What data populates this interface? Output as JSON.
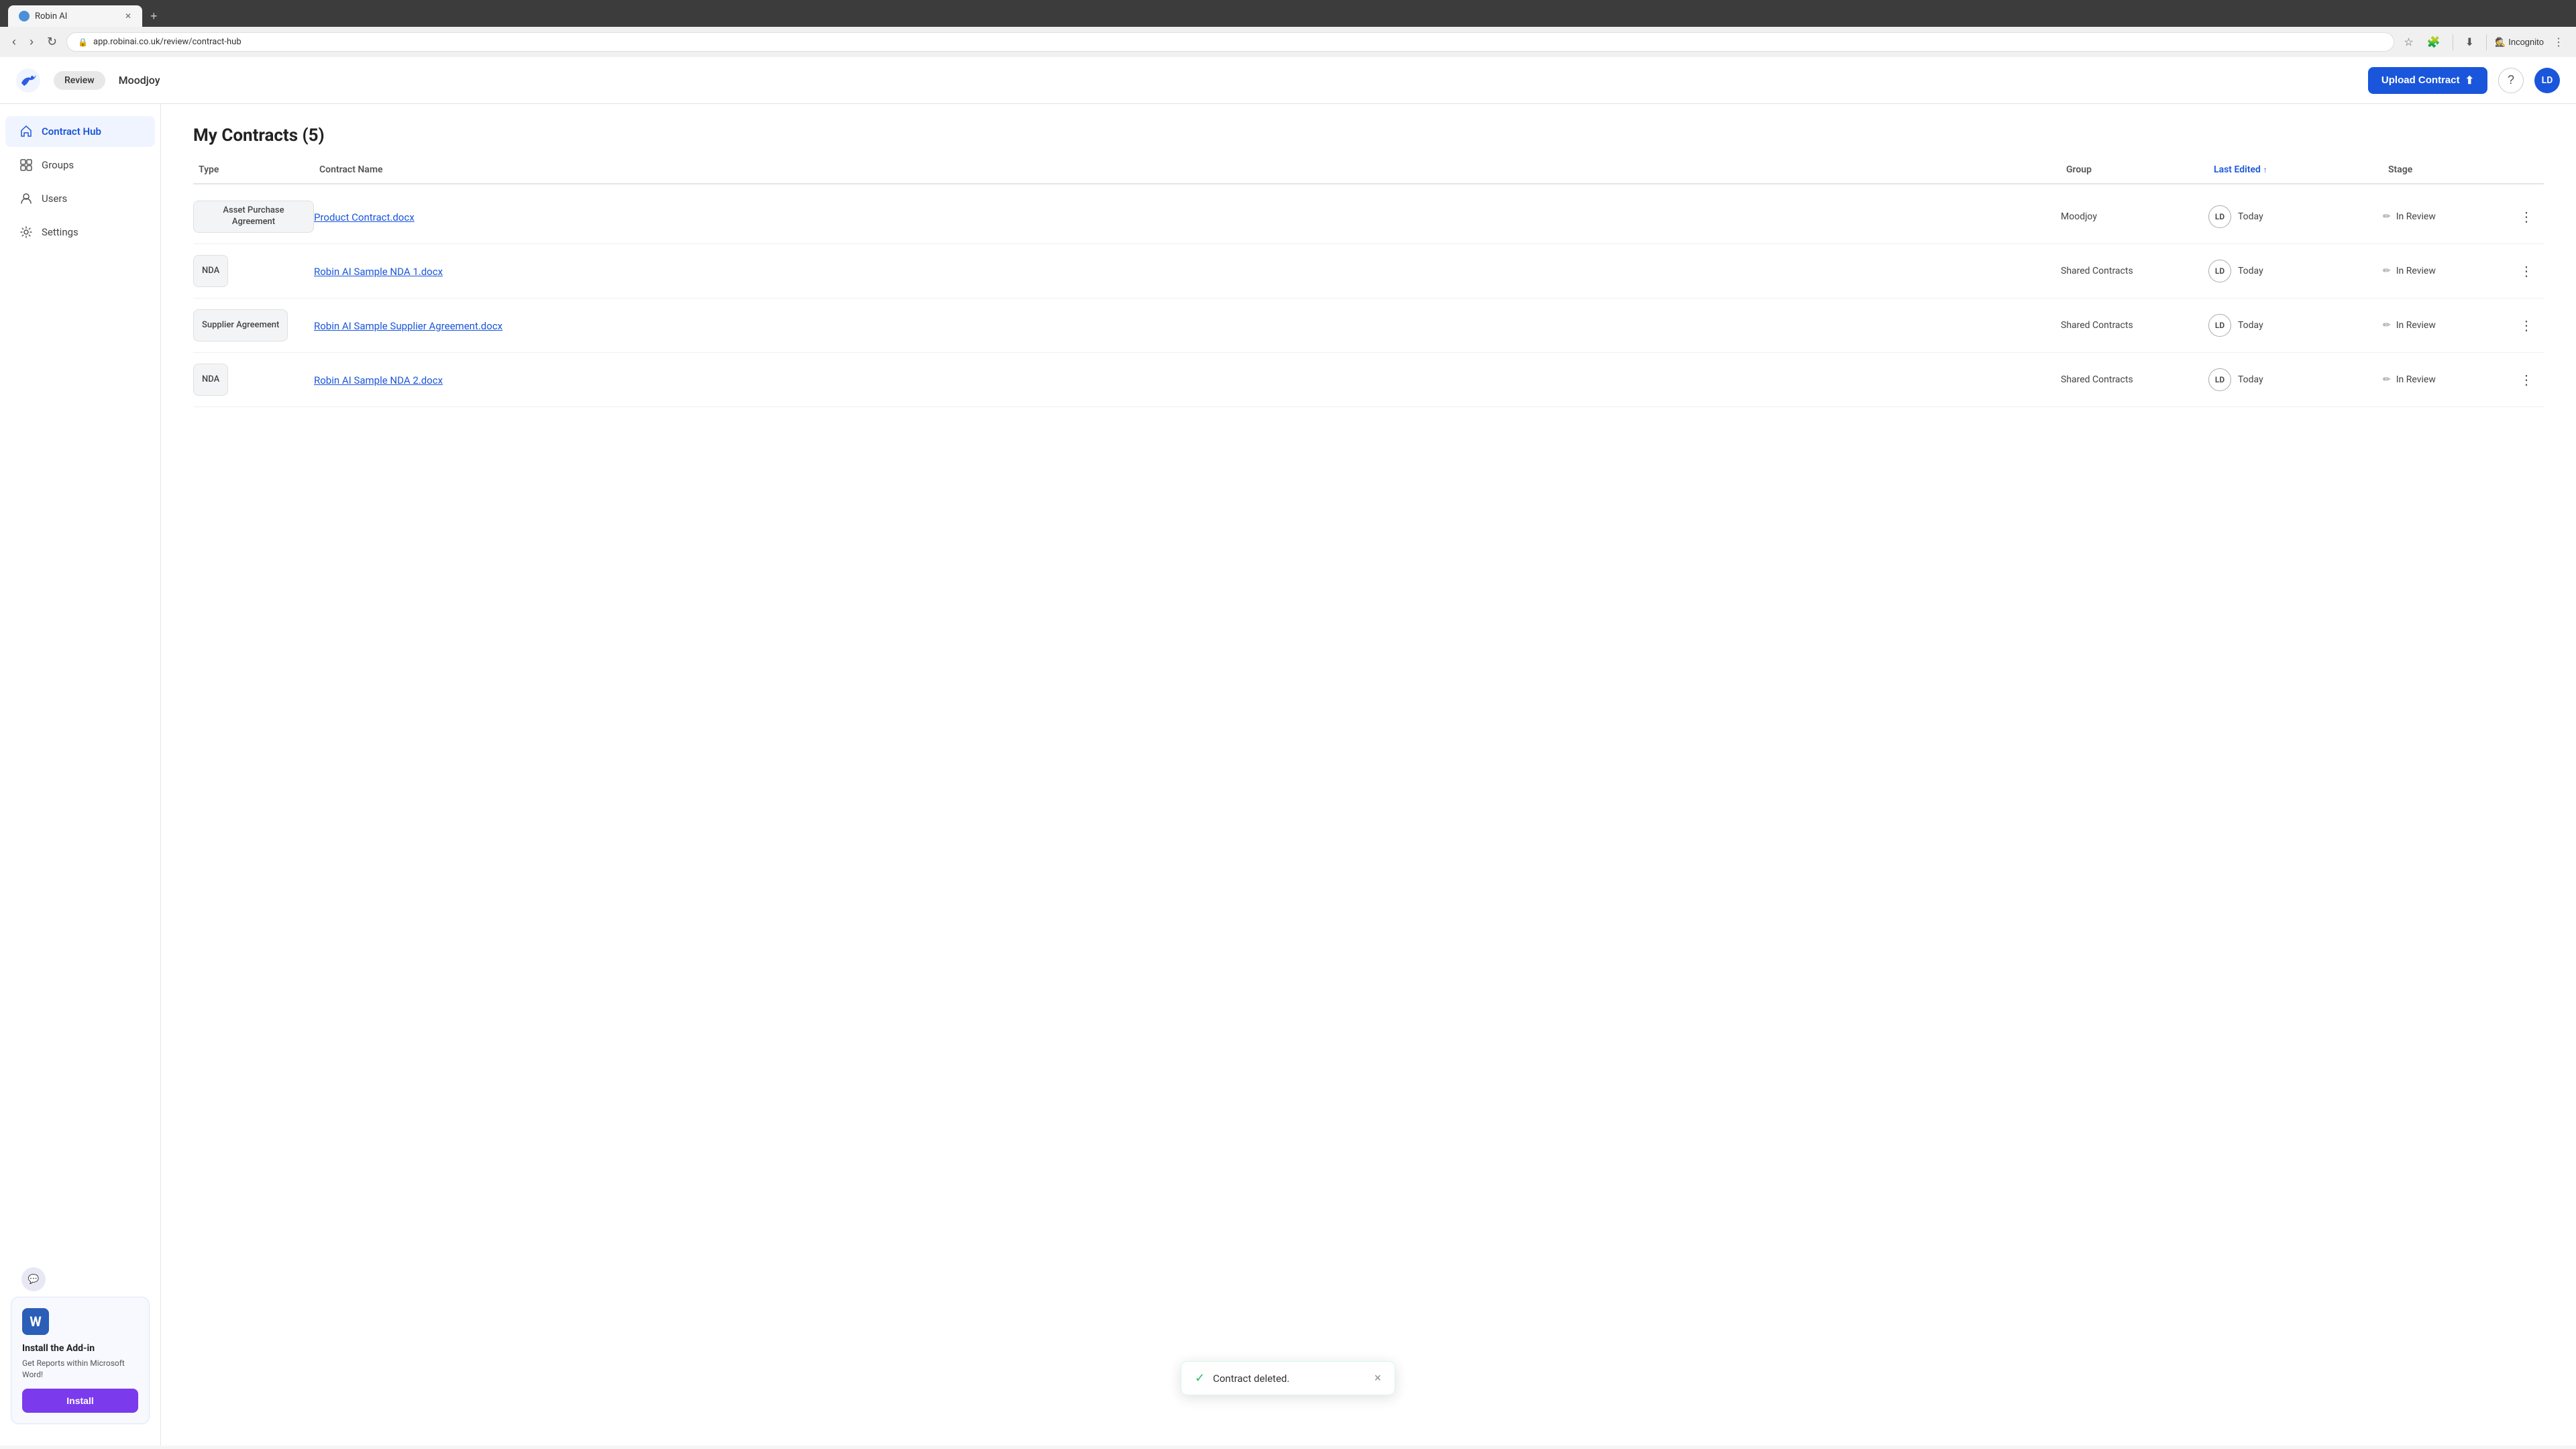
{
  "browser": {
    "tab_title": "Robin AI",
    "tab_favicon": "🤖",
    "address": "app.robinai.co.uk/review/contract-hub",
    "incognito_label": "Incognito",
    "new_tab_label": "+"
  },
  "topnav": {
    "review_badge": "Review",
    "company": "Moodjoy",
    "upload_button": "Upload Contract",
    "upload_icon": "↑",
    "help_icon": "?",
    "user_initials": "LD"
  },
  "sidebar": {
    "items": [
      {
        "id": "contract-hub",
        "label": "Contract Hub",
        "active": true
      },
      {
        "id": "groups",
        "label": "Groups",
        "active": false
      },
      {
        "id": "users",
        "label": "Users",
        "active": false
      },
      {
        "id": "settings",
        "label": "Settings",
        "active": false
      }
    ],
    "addin": {
      "word_letter": "W",
      "title": "Install the Add-in",
      "description": "Get Reports within Microsoft Word!",
      "install_button": "Install"
    }
  },
  "main": {
    "page_title": "My Contracts (5)",
    "table": {
      "headers": [
        {
          "id": "type",
          "label": "Type",
          "sorted": false
        },
        {
          "id": "contract-name",
          "label": "Contract Name",
          "sorted": false
        },
        {
          "id": "group",
          "label": "Group",
          "sorted": false
        },
        {
          "id": "last-edited",
          "label": "Last Edited",
          "sorted": true
        },
        {
          "id": "stage",
          "label": "Stage",
          "sorted": false
        },
        {
          "id": "actions",
          "label": "",
          "sorted": false
        }
      ],
      "rows": [
        {
          "id": "row-1",
          "type": "Asset Purchase Agreement",
          "contract_name": "Product Contract.docx",
          "group": "Moodjoy",
          "last_edited_user": "LD",
          "last_edited_when": "Today",
          "stage": "In Review"
        },
        {
          "id": "row-2",
          "type": "NDA",
          "contract_name": "Robin AI Sample NDA 1.docx",
          "group": "Shared Contracts",
          "last_edited_user": "LD",
          "last_edited_when": "Today",
          "stage": "In Review"
        },
        {
          "id": "row-3",
          "type": "Supplier Agreement",
          "contract_name": "Robin AI Sample Supplier Agreement.docx",
          "group": "Shared Contracts",
          "last_edited_user": "LD",
          "last_edited_when": "Today",
          "stage": "In Review"
        },
        {
          "id": "row-4",
          "type": "NDA",
          "contract_name": "Robin AI Sample NDA 2.docx",
          "group": "Shared Contracts",
          "last_edited_user": "LD",
          "last_edited_when": "Today",
          "stage": "In Review"
        }
      ]
    }
  },
  "toast": {
    "message": "Contract deleted.",
    "icon": "✓",
    "close_label": "×"
  },
  "colors": {
    "brand_blue": "#1a56db",
    "brand_purple": "#7c3aed",
    "success_green": "#22c55e"
  }
}
